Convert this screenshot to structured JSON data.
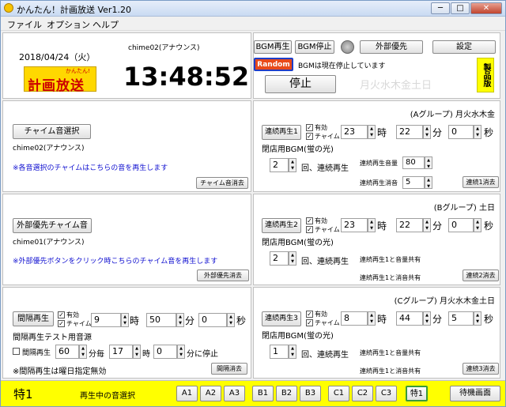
{
  "window": {
    "title": "かんたん！計画放送 Ver1.20",
    "min": "─",
    "max": "□",
    "close": "✕"
  },
  "menu": [
    "ファイル",
    "オプション",
    "ヘルプ"
  ],
  "header": {
    "date": "2018/04/24（火）",
    "logo": "計画放送",
    "logo_small": "かんたん!",
    "chime_name": "chime02(アナウンス)",
    "clock": "13:48:52",
    "btn_bgm_play": "BGM再生",
    "btn_bgm_stop": "BGM停止",
    "btn_external": "外部優先",
    "btn_settings": "設定",
    "btn_random": "Random",
    "bgm_status": "BGMは現在停止しています",
    "btn_stop": "停止",
    "weekdays": "月火水木金土日",
    "product_badge": "製品版"
  },
  "chime_section": {
    "btn_select": "チャイム音選択",
    "file": "chime02(アナウンス)",
    "note": "※各音選択のチャイムはこちらの音を再生します",
    "btn_clear": "チャイム音消去"
  },
  "external_section": {
    "btn_select": "外部優先チャイム音",
    "file": "chime01(アナウンス)",
    "note": "※外部優先ボタンをクリック時こちらのチャイム音を再生します",
    "btn_clear": "外部優先消去"
  },
  "interval_section": {
    "btn_play": "間隔再生",
    "chk_enabled": "有効",
    "chk_chime": "チャイム",
    "hour": "9",
    "hour_unit": "時",
    "minute": "50",
    "minute_unit": "分",
    "second": "0",
    "second_unit": "秒",
    "test_source": "間隔再生テスト用音源",
    "chk_interval": "間隔再生",
    "every_minutes": "60",
    "every_unit": "分毎",
    "stop_hour": "17",
    "stop_hour_unit": "時",
    "stop_minute": "0",
    "stop_minute_unit": "分に停止",
    "note": "※間隔再生は曜日指定無効",
    "btn_clear": "間隔消去"
  },
  "groups": [
    {
      "header": "(Aグループ) 月火水木金",
      "btn_play": "連続再生1",
      "chk_enabled": "有効",
      "chk_chime": "チャイム",
      "hour": "23",
      "hour_unit": "時",
      "minute": "22",
      "minute_unit": "分",
      "second": "0",
      "second_unit": "秒",
      "bgm": "閉店用BGM(蛍の光)",
      "repeat": "2",
      "repeat_unit": "回、連続再生",
      "extra1_label": "連続再生音量",
      "extra1_value": "80",
      "extra2_label": "連続再生消音",
      "extra2_value": "5",
      "btn_clear": "連続1消去"
    },
    {
      "header": "(Bグループ) 土日",
      "btn_play": "連続再生2",
      "chk_enabled": "有効",
      "chk_chime": "チャイム",
      "hour": "23",
      "hour_unit": "時",
      "minute": "22",
      "minute_unit": "分",
      "second": "0",
      "second_unit": "秒",
      "bgm": "閉店用BGM(蛍の光)",
      "repeat": "2",
      "repeat_unit": "回、連続再生",
      "extra1_label": "連続再生1と音量共有",
      "extra1_value": "",
      "extra2_label": "連続再生1と消音共有",
      "extra2_value": "",
      "btn_clear": "連続2消去"
    },
    {
      "header": "(Cグループ) 月火水木金土日",
      "btn_play": "連続再生3",
      "chk_enabled": "有効",
      "chk_chime": "チャイム",
      "hour": "8",
      "hour_unit": "時",
      "minute": "44",
      "minute_unit": "分",
      "second": "5",
      "second_unit": "秒",
      "bgm": "閉店用BGM(蛍の光)",
      "repeat": "1",
      "repeat_unit": "回、連続再生",
      "extra1_label": "連続再生1と音量共有",
      "extra1_value": "",
      "extra2_label": "連続再生1と消音共有",
      "extra2_value": "",
      "btn_clear": "連続3消去"
    }
  ],
  "bottom": {
    "special_label": "特1",
    "selecting": "再生中の音選択",
    "buttons": [
      "A1",
      "A2",
      "A3",
      "B1",
      "B2",
      "B3",
      "C1",
      "C2",
      "C3",
      "特1"
    ],
    "btn_standby": "待機画面"
  }
}
